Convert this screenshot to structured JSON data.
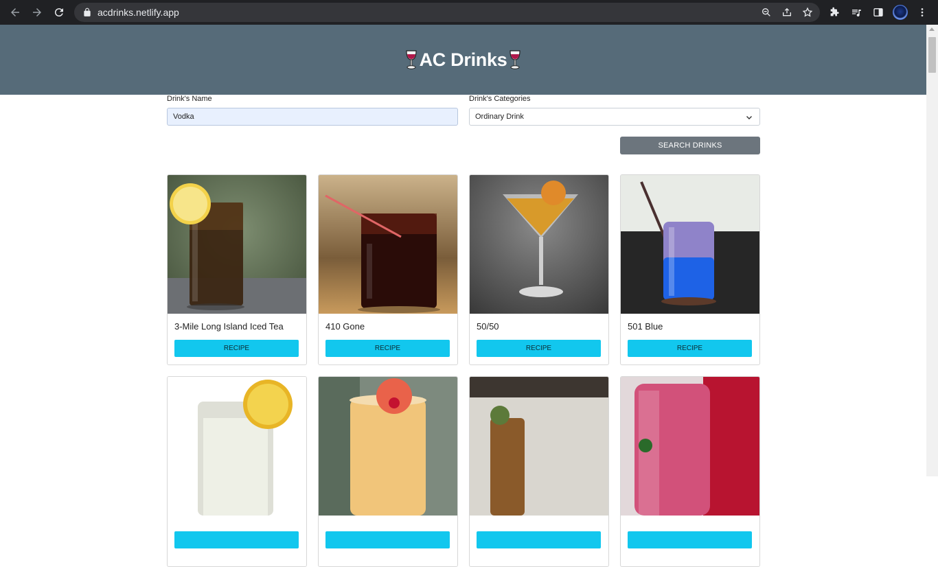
{
  "browser": {
    "url": "acdrinks.netlify.app"
  },
  "header": {
    "title": "AC Drinks"
  },
  "form": {
    "name_label": "Drink's Name",
    "name_value": "Vodka",
    "category_label": "Drink's Categories",
    "category_value": "Ordinary Drink",
    "search_button": "SEARCH DRINKS"
  },
  "drinks": [
    {
      "name": "3-Mile Long Island Iced Tea",
      "button": "RECIPE"
    },
    {
      "name": "410 Gone",
      "button": "RECIPE"
    },
    {
      "name": "50/50",
      "button": "RECIPE"
    },
    {
      "name": "501 Blue",
      "button": "RECIPE"
    },
    {
      "name": "",
      "button": ""
    },
    {
      "name": "",
      "button": ""
    },
    {
      "name": "",
      "button": ""
    },
    {
      "name": "",
      "button": ""
    }
  ],
  "colors": {
    "header_bg": "#566b79",
    "recipe_button": "#12c7ee",
    "search_button": "#6c757d"
  }
}
